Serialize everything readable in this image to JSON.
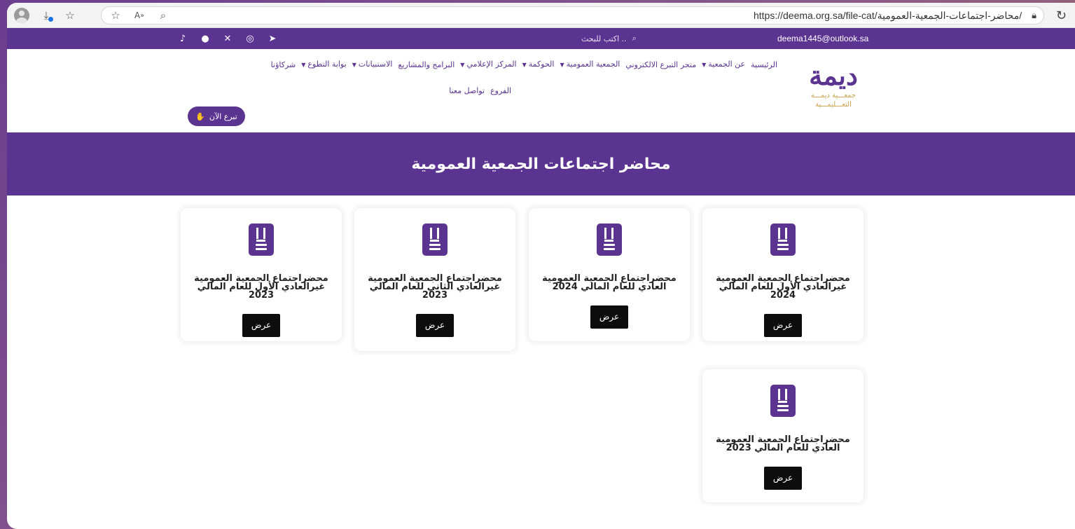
{
  "browser": {
    "url": "https://deema.org.sa/file-cat/محاضر-اجتماعات-الجمعية-العمومية/"
  },
  "topbar": {
    "search_placeholder": "اكتب للبحث ..",
    "email": "deema1445@outlook.sa",
    "socials": [
      "tiktok-icon",
      "snapchat-icon",
      "x-icon",
      "instagram-icon",
      "telegram-icon"
    ]
  },
  "logo": {
    "main": "ديمة",
    "sub1": "جمعـــية ديمـــة",
    "sub2": "التعـــليمـــية"
  },
  "nav": {
    "row1": [
      "الرئيسية",
      "عن الجمعية",
      "متجر التبرع الالكتروني",
      "الجمعية العمومية",
      "الحوكمة",
      "المركز الإعلامي",
      "البرامج والمشاريع",
      "الاستبيانات",
      "بوابة التطوع",
      "شركاؤنا"
    ],
    "row2": [
      "الفروع",
      "تواصل معنا"
    ]
  },
  "donate": {
    "label": "تبرع الآن"
  },
  "hero": {
    "title": "محاضر اجتماعات الجمعية العمومية"
  },
  "cards": [
    {
      "title": "محضراجتماع الجمعية العمومية غيرالعادي الأول للعام المالي 2024",
      "button": "عرض"
    },
    {
      "title": "محضراجتماع الجمعية العمومية العادي للعام المالي 2024",
      "button": "عرض"
    },
    {
      "title": "محضراجتماع الجمعية العمومية غيرالعادي الثاني للعام المالي 2023",
      "button": "عرض"
    },
    {
      "title": "محضراجتماع الجمعية العمومية غيرالعادي الأول للعام المالي 2023",
      "button": "عرض"
    },
    {
      "title": "محضراجتماع الجمعية العمومية العادي للعام المالي 2023",
      "button": "عرض"
    }
  ],
  "colors": {
    "brand": "#5b3391",
    "gold": "#c9a24a",
    "button": "#0d0d0d"
  }
}
